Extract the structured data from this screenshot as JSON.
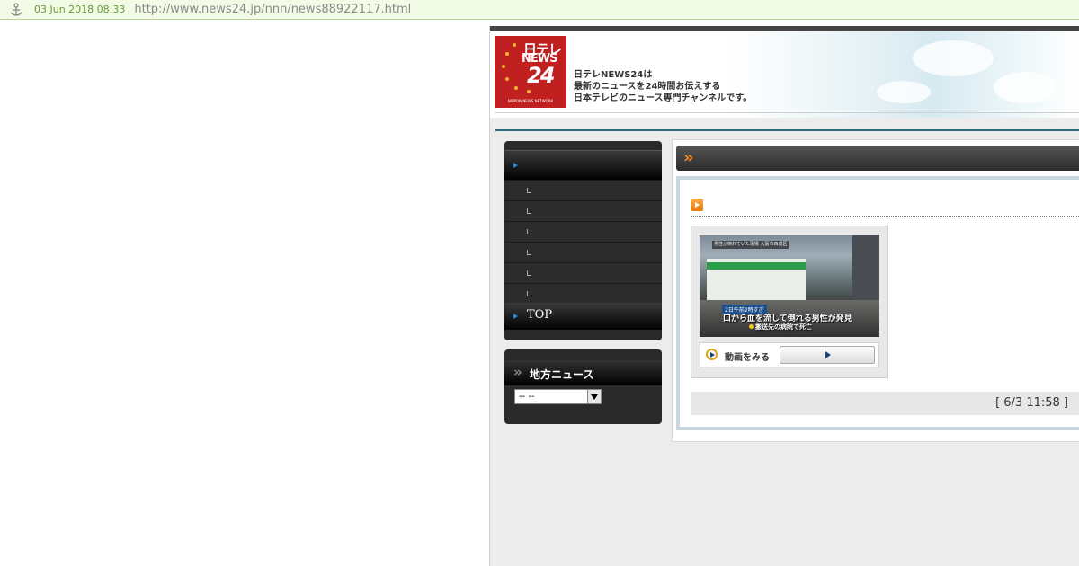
{
  "archive_bar": {
    "icon": "wayback-anchor-icon",
    "date": "03 Jun 2018 08:33",
    "url": "http://www.news24.jp/nnn/news88922117.html"
  },
  "header": {
    "logo": {
      "line1": "日テレ",
      "line2": "NEWS",
      "line3": "24",
      "small": "NIPPON NEWS NETWORK"
    },
    "tagline": [
      "日テレNEWS24は",
      "最新のニュースを24時間お伝えする",
      "日本テレビのニュース専門チャンネルです。"
    ]
  },
  "left_nav": {
    "items": [
      "",
      "",
      "",
      "",
      "",
      ""
    ],
    "top_label": "TOP"
  },
  "local_news": {
    "title": "地方ニュース",
    "select_value": "--  --"
  },
  "article": {
    "video": {
      "caption_top": "男性が倒れていた現場 大阪市西成区",
      "caption_mid": "2日午前2時すぎ",
      "caption_main": "口から血を流して倒れる男性が発見",
      "caption_sub": "搬送先の病院で死亡",
      "watch_label": "動画をみる"
    },
    "timestamp": "[ 6/3 11:58 ]"
  },
  "colors": {
    "accent_orange": "#f08b1a",
    "logo_red": "#c0201f",
    "nav_blue": "#2f8bd8",
    "archive_green": "#6a9a3a"
  }
}
